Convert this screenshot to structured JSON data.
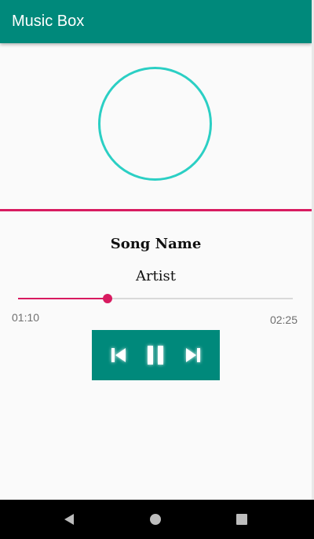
{
  "app_bar": {
    "title": "Music Box"
  },
  "player": {
    "song_name": "Song Name",
    "artist": "Artist",
    "elapsed": "01:10",
    "total": "02:25",
    "progress_fraction": 0.327
  },
  "controls": {
    "previous_icon": "skip-previous-icon",
    "pause_icon": "pause-icon",
    "next_icon": "skip-next-icon"
  },
  "nav": {
    "back_icon": "back-triangle-icon",
    "home_icon": "home-circle-icon",
    "recents_icon": "recents-square-icon"
  },
  "colors": {
    "primary": "#00897b",
    "accent": "#d81b60",
    "circle": "#2bcfc4",
    "background": "#fafafa"
  }
}
